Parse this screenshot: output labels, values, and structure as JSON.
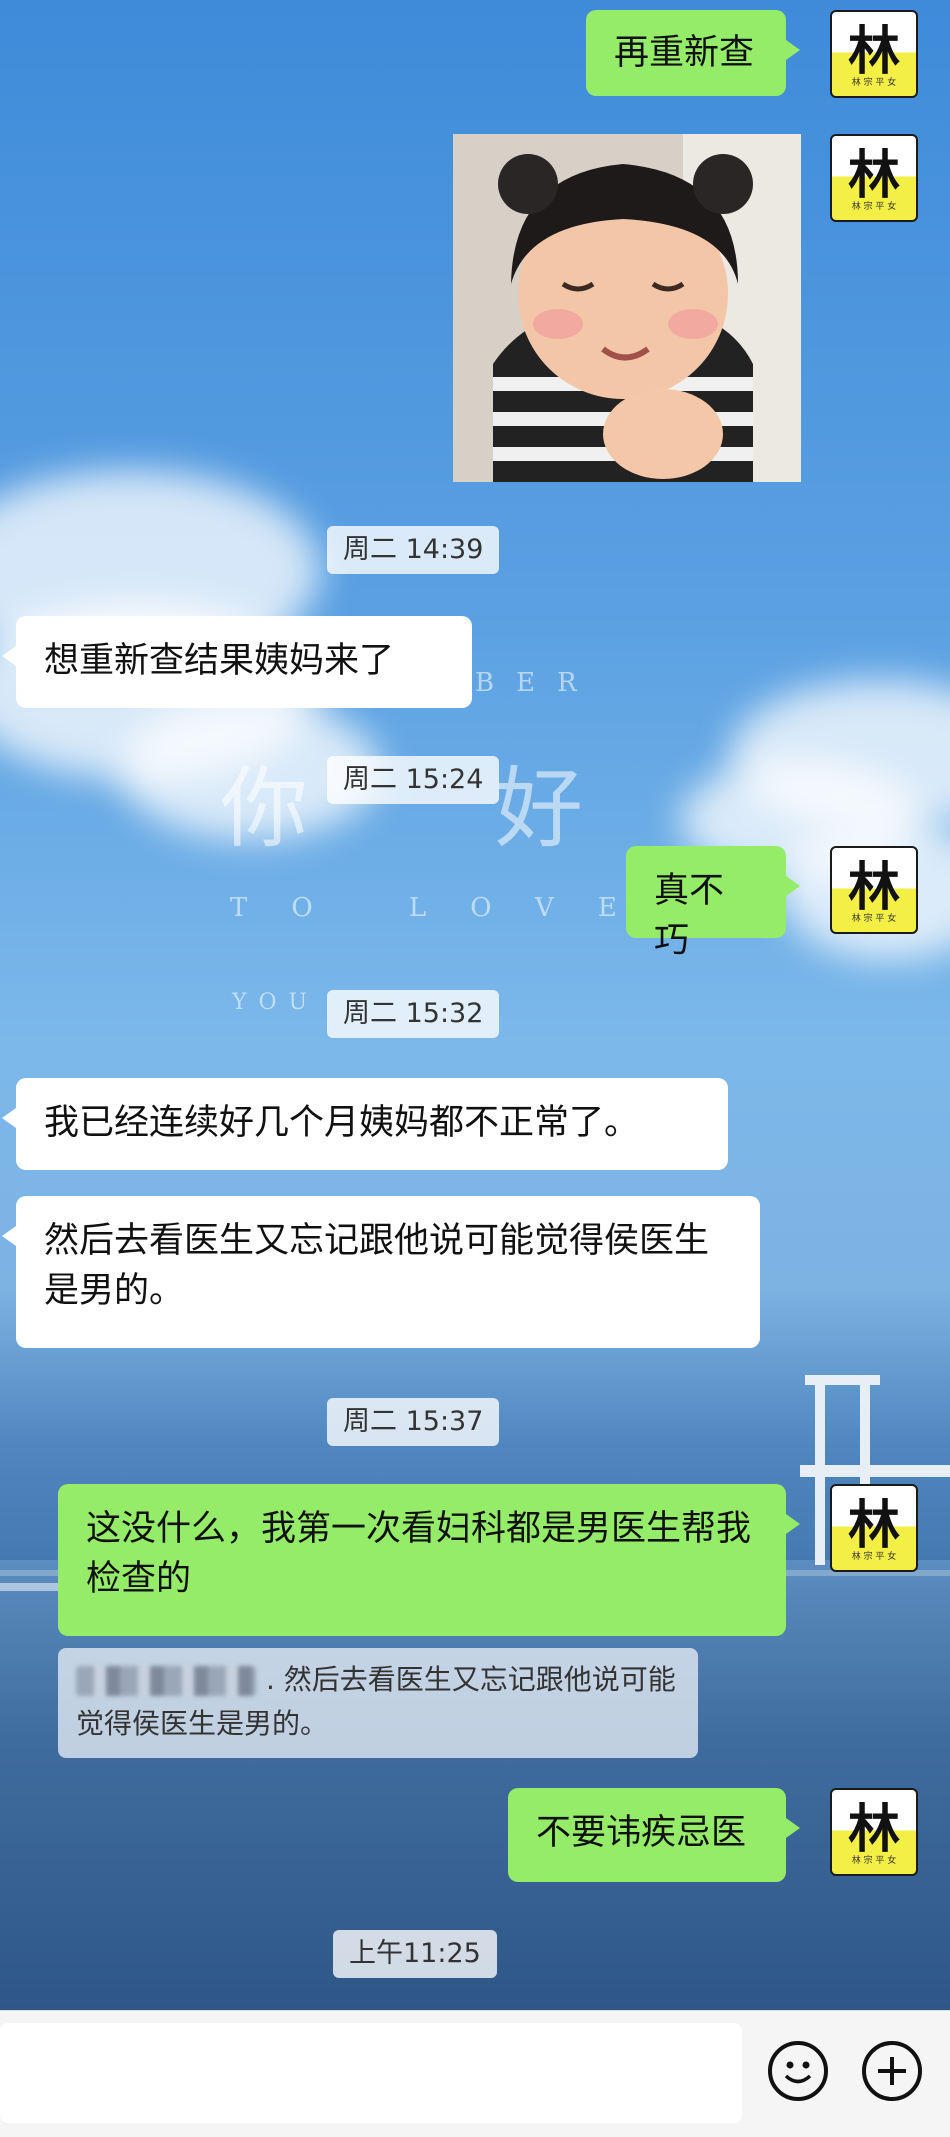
{
  "background": {
    "deco_top": "BER",
    "deco_title_left": "你",
    "deco_title_right": "好",
    "deco_line": "TO LOVE",
    "deco_you": "YOU"
  },
  "avatar": {
    "glyph": "林",
    "caption": "林 宗 平 女"
  },
  "messages": [
    {
      "side": "me",
      "type": "text",
      "text": "再重新查"
    },
    {
      "side": "me",
      "type": "image",
      "alt": "sticker-baby-smiling"
    },
    {
      "type": "time",
      "text": "周二 14:39"
    },
    {
      "side": "them",
      "type": "text",
      "text": "想重新查结果姨妈来了"
    },
    {
      "type": "time",
      "text": "周二 15:24"
    },
    {
      "side": "me",
      "type": "text",
      "text": "真不巧"
    },
    {
      "type": "time",
      "text": "周二 15:32"
    },
    {
      "side": "them",
      "type": "text",
      "text": "我已经连续好几个月姨妈都不正常了。"
    },
    {
      "side": "them",
      "type": "text",
      "text": "然后去看医生又忘记跟他说可能觉得侯医生是男的。"
    },
    {
      "type": "time",
      "text": "周二 15:37"
    },
    {
      "side": "me",
      "type": "text",
      "text": "这没什么，我第一次看妇科都是男医生帮我检查的"
    },
    {
      "side": "me",
      "type": "text",
      "text": "不要讳疾忌医"
    },
    {
      "type": "time",
      "text": "上午11:25"
    }
  ],
  "quote": {
    "text": ". 然后去看医生又忘记跟他说可能觉得侯医生是男的。"
  },
  "input_bar": {
    "emoji_icon": "smiley-icon",
    "plus_icon": "plus-circle-icon"
  }
}
